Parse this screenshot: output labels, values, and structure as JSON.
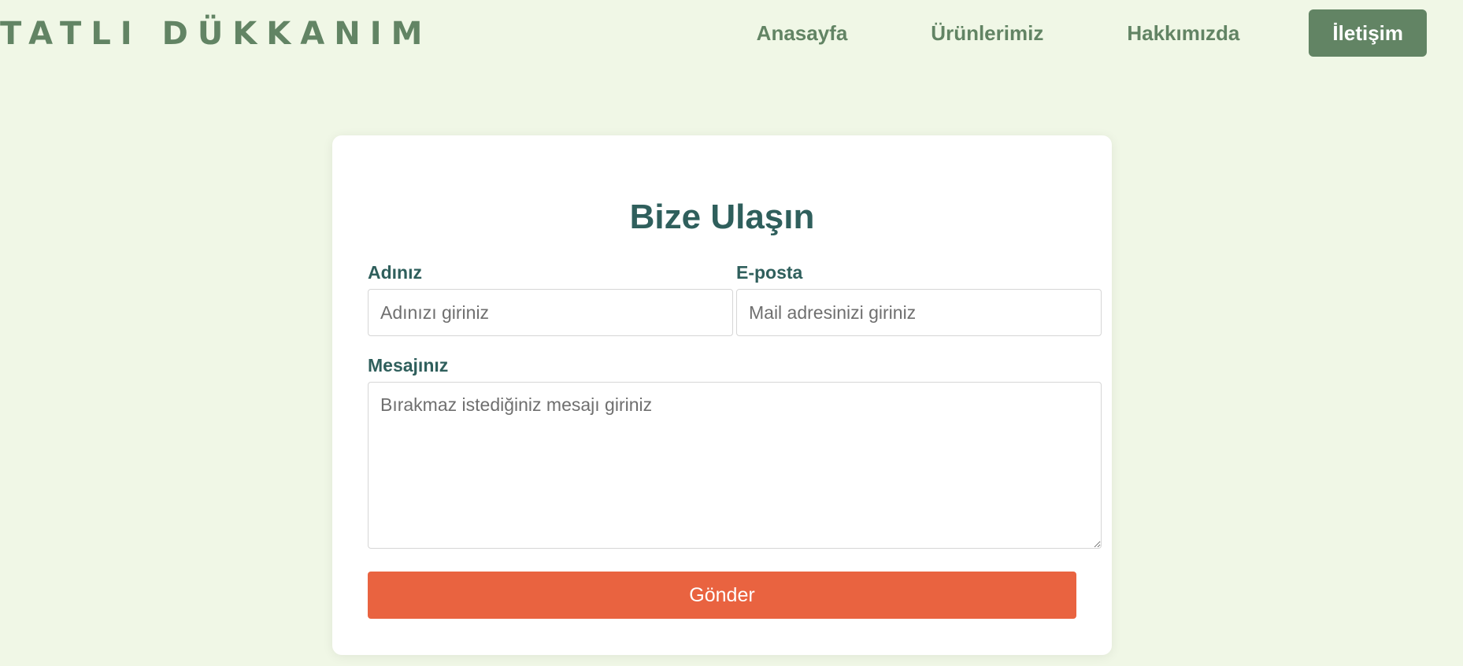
{
  "header": {
    "logo": "TATLI DÜKKANIM",
    "nav": [
      {
        "label": "Anasayfa"
      },
      {
        "label": "Ürünlerimiz"
      },
      {
        "label": "Hakkımızda"
      },
      {
        "label": "İletişim",
        "active": true
      }
    ]
  },
  "form": {
    "title": "Bize Ulaşın",
    "name": {
      "label": "Adınız",
      "placeholder": "Adınızı giriniz",
      "value": ""
    },
    "email": {
      "label": "E-posta",
      "placeholder": "Mail adresinizi giriniz",
      "value": ""
    },
    "message": {
      "label": "Mesajınız",
      "placeholder": "Bırakmaz istediğiniz mesajı giriniz",
      "value": ""
    },
    "submit_label": "Gönder"
  },
  "colors": {
    "background": "#f0f7e6",
    "brand_green": "#628464",
    "heading_teal": "#2f5f5c",
    "submit_orange": "#e96340"
  }
}
